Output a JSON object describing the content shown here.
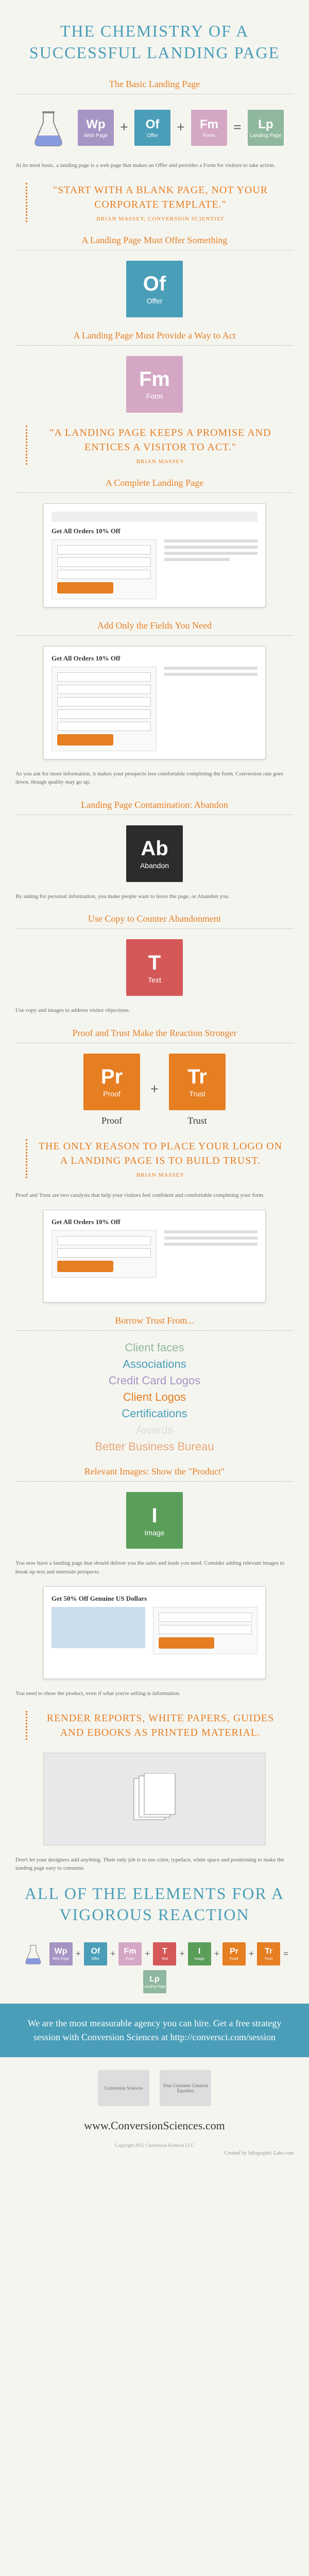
{
  "title": "THE CHEMISTRY OF A SUCCESSFUL LANDING PAGE",
  "sections": {
    "basic": {
      "title": "The Basic Landing Page",
      "elements": {
        "wp": {
          "symbol": "Wp",
          "name": "Web Page",
          "color": "#a594c4"
        },
        "of": {
          "symbol": "Of",
          "name": "Offer",
          "color": "#4a9eb8"
        },
        "fm": {
          "symbol": "Fm",
          "name": "Form",
          "color": "#d4a8c4"
        },
        "lp": {
          "symbol": "Lp",
          "name": "Landing Page",
          "color": "#8fb89e"
        }
      },
      "body": "At its most basic, a landing page is a web page that makes an Offer and provides a Form for visitors to take action.",
      "quote": "\"START WITH A BLANK PAGE, NOT YOUR CORPORATE TEMPLATE.\"",
      "attrib": "BRIAN MASSEY, CONVERSION SCIENTIST"
    },
    "offer": {
      "title": "A Landing Page Must Offer Something",
      "element": {
        "symbol": "Of",
        "name": "Offer",
        "color": "#4a9eb8"
      }
    },
    "form": {
      "title": "A Landing Page Must Provide a Way to Act",
      "element": {
        "symbol": "Fm",
        "name": "Form",
        "color": "#d4a8c4"
      },
      "quote": "\"A LANDING PAGE KEEPS A PROMISE AND ENTICES A VISITOR TO ACT.\"",
      "attrib": "BRIAN MASSEY"
    },
    "complete": {
      "title": "A Complete Landing Page",
      "mock_title": "Get All Orders 10% Off"
    },
    "fields": {
      "title": "Add Only the Fields You Need",
      "mock_title": "Get All Orders 10% Off",
      "body": "As you ask for more information, it makes your prospects less comfortable completing the form. Conversion rate goes down, though quality may go up."
    },
    "abandon": {
      "title": "Landing Page Contamination: Abandon",
      "element": {
        "symbol": "Ab",
        "name": "Abandon",
        "color": "#2c2c2c"
      },
      "body": "By asking for personal information, you make people want to leave the page, or Abandon you."
    },
    "text": {
      "title": "Use Copy to Counter Abandonment",
      "element": {
        "symbol": "T",
        "name": "Text",
        "color": "#d45858"
      },
      "body": "Use copy and images to address visitor objections."
    },
    "proof_trust": {
      "title": "Proof and Trust Make the Reaction Stronger",
      "proof": {
        "symbol": "Pr",
        "name": "Proof",
        "color": "#e67e22",
        "label": "Proof"
      },
      "trust": {
        "symbol": "Tr",
        "name": "Trust",
        "color": "#e67e22",
        "label": "Trust"
      },
      "quote": "THE ONLY REASON TO PLACE YOUR LOGO ON A LANDING PAGE IS TO BUILD TRUST.",
      "attrib": "BRIAN MASSEY",
      "body": "Proof and Trust are two catalysts that help your visitors feel confident and comfortable completing your form.",
      "mock_title": "Get All Orders 10% Off"
    },
    "borrow": {
      "title": "Borrow Trust From...",
      "items": [
        {
          "text": "Client faces",
          "color": "#8fb89e"
        },
        {
          "text": "Associations",
          "color": "#4a9eb8"
        },
        {
          "text": "Credit Card Logos",
          "color": "#a594c4"
        },
        {
          "text": "Client Logos",
          "color": "#e67e22"
        },
        {
          "text": "Certifications",
          "color": "#4a9eb8"
        },
        {
          "text": "Awards",
          "color": "#ddd"
        },
        {
          "text": "Better Business Bureau",
          "color": "#e8a87c"
        }
      ]
    },
    "images": {
      "title": "Relevant Images: Show the \"Product\"",
      "element": {
        "symbol": "I",
        "name": "Image",
        "color": "#5a9e5a"
      },
      "body": "You now have a landing page that should deliver you the sales and leads you need. Consider adding relevant images to break up text and entertain prospects.",
      "mock_title": "Get 50% Off Genuine US Dollars",
      "body2": "You need to show the product, even if what you're selling is information."
    },
    "render": {
      "quote": "RENDER REPORTS, WHITE PAPERS, GUIDES AND EBOOKS AS PRINTED MATERIAL.",
      "body": "Don't let your designers add anything. Their only job is to use color, typeface, white space and positioning to make the landing page easy to consume."
    },
    "all_elements": {
      "title": "ALL OF THE ELEMENTS FOR A VIGOROUS REACTION",
      "elements": [
        {
          "symbol": "Wp",
          "name": "Web Page",
          "color": "#a594c4"
        },
        {
          "symbol": "Of",
          "name": "Offer",
          "color": "#4a9eb8"
        },
        {
          "symbol": "Fm",
          "name": "Form",
          "color": "#d4a8c4"
        },
        {
          "symbol": "T",
          "name": "Text",
          "color": "#d45858"
        },
        {
          "symbol": "I",
          "name": "Image",
          "color": "#5a9e5a"
        },
        {
          "symbol": "Pr",
          "name": "Proof",
          "color": "#e67e22"
        },
        {
          "symbol": "Tr",
          "name": "Trust",
          "color": "#e67e22"
        },
        {
          "symbol": "Lp",
          "name": "Landing Page",
          "color": "#8fb89e"
        }
      ]
    },
    "cta": {
      "text": "We are the most measurable agency you can hire. Get a free strategy session with Conversion Sciences at http://conversci.com/session"
    },
    "footer": {
      "url": "www.ConversionSciences.com",
      "copyright": "Copyright 2012 Conversion Sciences LLC",
      "labs": "Created by Infographic Labs.com"
    }
  }
}
